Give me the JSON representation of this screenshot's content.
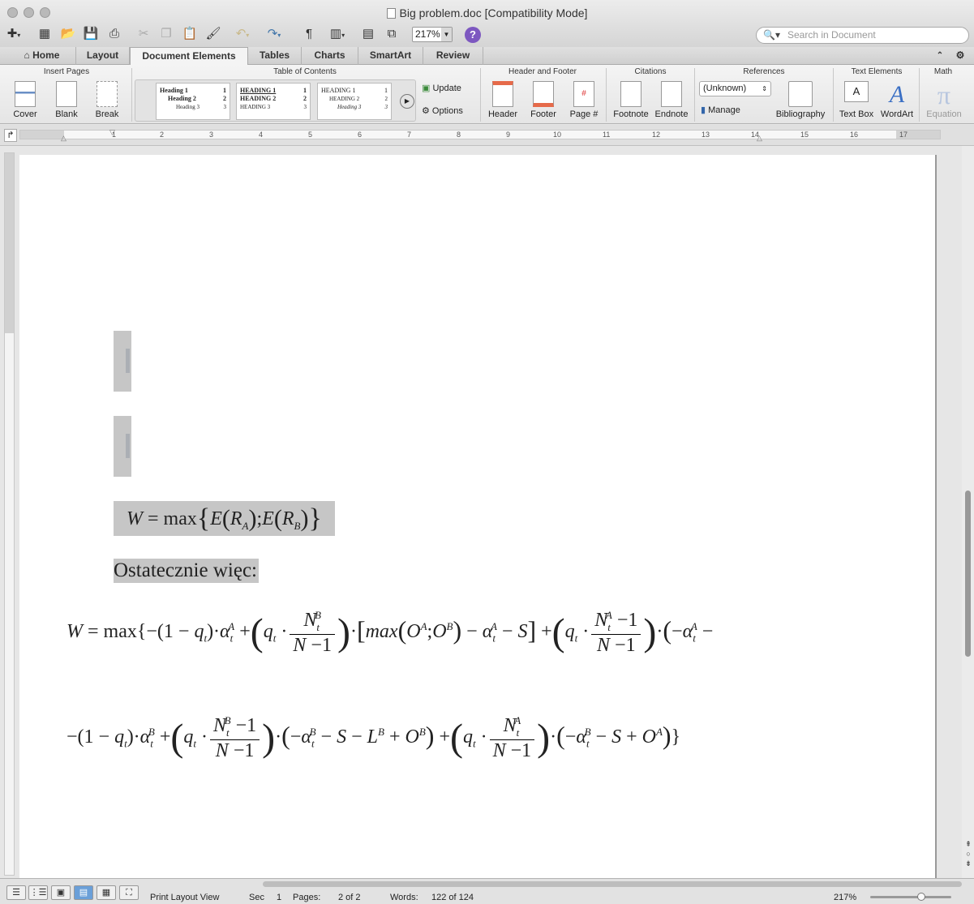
{
  "window": {
    "title": "Big problem.doc [Compatibility Mode]",
    "zoom": "217%",
    "search_placeholder": "Search in Document"
  },
  "tabs": [
    {
      "label": "Home",
      "active": false
    },
    {
      "label": "Layout",
      "active": false
    },
    {
      "label": "Document Elements",
      "active": true
    },
    {
      "label": "Tables",
      "active": false
    },
    {
      "label": "Charts",
      "active": false
    },
    {
      "label": "SmartArt",
      "active": false
    },
    {
      "label": "Review",
      "active": false
    }
  ],
  "ribbon": {
    "groups": {
      "insert_pages": "Insert Pages",
      "toc": "Table of Contents",
      "header_footer": "Header and Footer",
      "citations": "Citations",
      "references": "References",
      "text_elements": "Text Elements",
      "math": "Math"
    },
    "buttons": {
      "cover": "Cover",
      "blank": "Blank",
      "break": "Break",
      "update": "Update",
      "options": "Options",
      "header": "Header",
      "footer": "Footer",
      "page_num": "Page #",
      "footnote": "Footnote",
      "endnote": "Endnote",
      "manage": "Manage",
      "bibliography": "Bibliography",
      "text_box": "Text Box",
      "wordart": "WordArt",
      "equation": "Equation"
    },
    "citation_style": "(Unknown)",
    "toc_styles": [
      {
        "h1": "Heading 1",
        "h2": "Heading 2",
        "h3": "Heading 3",
        "n1": "1",
        "n2": "2",
        "n3": "3"
      },
      {
        "h1": "HEADING 1",
        "h2": "HEADING 2",
        "h3": "HEADING 3",
        "n1": "1",
        "n2": "2",
        "n3": "3"
      },
      {
        "h1": "HEADING 1",
        "h2": "HEADING 2",
        "h3": "Heading 3",
        "n1": "1",
        "n2": "2",
        "n3": "3"
      }
    ]
  },
  "ruler": {
    "numbers": [
      "1",
      "2",
      "3",
      "4",
      "5",
      "6",
      "7",
      "8",
      "9",
      "10",
      "11",
      "12",
      "13",
      "14",
      "15",
      "16",
      "17"
    ]
  },
  "document": {
    "paragraph_text": "Ostatecznie więc:"
  },
  "status": {
    "view": "Print Layout View",
    "sec_label": "Sec",
    "sec_value": "1",
    "pages_label": "Pages:",
    "pages_value": "2 of 2",
    "words_label": "Words:",
    "words_value": "122 of 124",
    "zoom": "217%"
  }
}
